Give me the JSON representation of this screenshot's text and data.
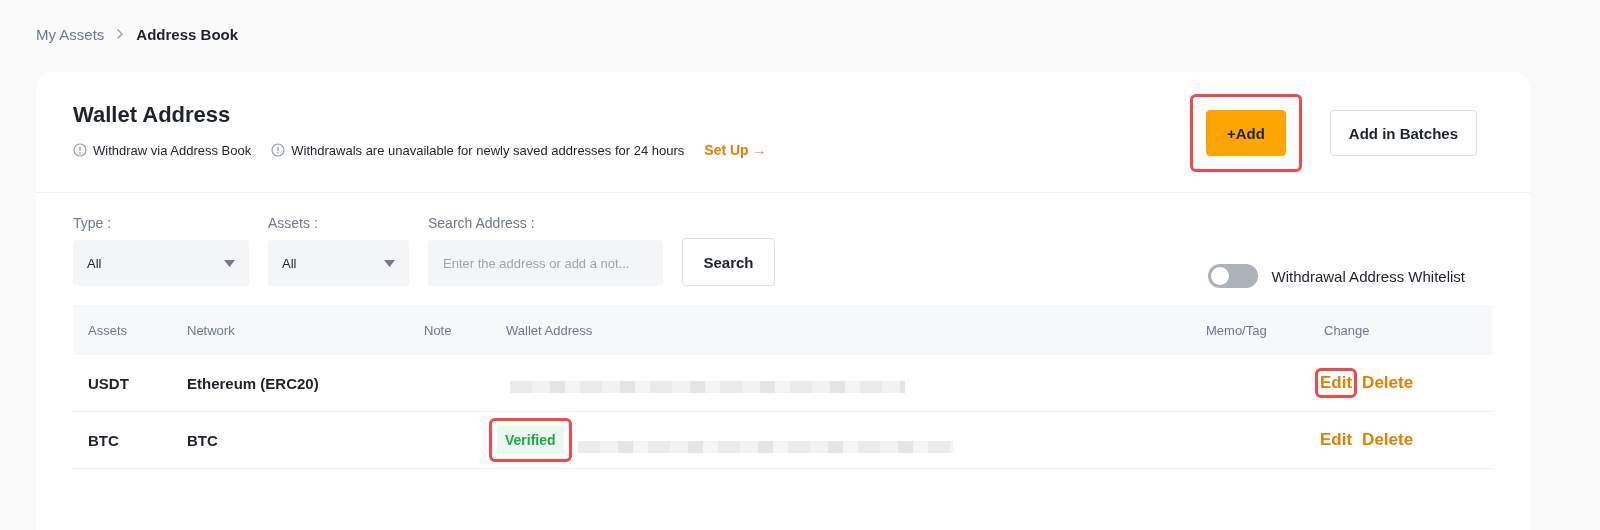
{
  "breadcrumb": [
    {
      "label": "My Assets",
      "current": false
    },
    {
      "label": "Address Book",
      "current": true
    }
  ],
  "header": {
    "title": "Wallet Address",
    "notes": [
      "Withdraw via Address Book",
      "Withdrawals are unavailable for newly saved addresses for 24 hours"
    ],
    "setup_link": "Set Up →"
  },
  "actions": [
    {
      "label": "+Add",
      "kind": "primary",
      "highlighted": true
    },
    {
      "label": "Add in Batches",
      "kind": "secondary",
      "highlighted": false
    }
  ],
  "filters": [
    {
      "kind": "select",
      "label": "Type :",
      "value": "All"
    },
    {
      "kind": "select",
      "label": "Assets :",
      "value": "All"
    },
    {
      "kind": "search",
      "label": "Search Address :",
      "placeholder": "Enter the address or add a not..."
    }
  ],
  "search_button": "Search",
  "whitelist": {
    "label": "Withdrawal Address Whitelist",
    "on": false
  },
  "table": {
    "columns": [
      "Assets",
      "Network",
      "Note",
      "Wallet Address",
      "Memo/Tag",
      "Change"
    ],
    "rows": [
      {
        "asset": "USDT",
        "network": "Ethereum (ERC20)",
        "links": [
          {
            "label": "Edit",
            "highlighted": true
          },
          {
            "label": "Delete",
            "highlighted": false
          }
        ]
      },
      {
        "asset": "BTC",
        "network": "BTC",
        "badge": {
          "label": "Verified",
          "highlighted": true
        },
        "links": [
          {
            "label": "Edit",
            "highlighted": false
          },
          {
            "label": "Delete",
            "highlighted": false
          }
        ]
      }
    ]
  }
}
